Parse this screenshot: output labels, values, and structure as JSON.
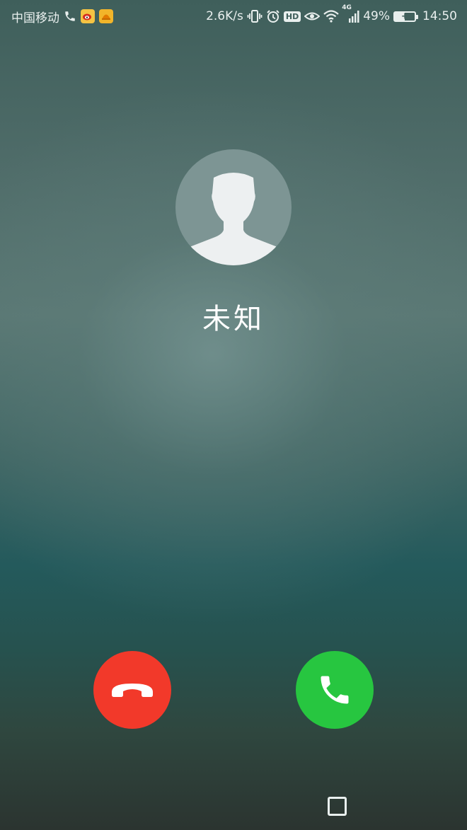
{
  "status_bar": {
    "carrier": "中国移动",
    "net_speed": "2.6K/s",
    "network_type": "4G",
    "battery_percent": "49%",
    "battery_level": 0.49,
    "time": "14:50",
    "hd_label": "HD",
    "icons": [
      "phone-icon",
      "weibo-app-icon",
      "app-notification-icon",
      "vibrate-icon",
      "alarm-icon",
      "hd-icon",
      "eye-comfort-icon",
      "wifi-icon",
      "signal-icon",
      "battery-charging-icon"
    ]
  },
  "caller": {
    "name": "未知",
    "avatar_icon": "default-avatar-icon"
  },
  "actions": {
    "decline_icon": "hang-up-icon",
    "answer_icon": "phone-answer-icon"
  },
  "navigation": {
    "recents_icon": "square-recents-icon"
  },
  "colors": {
    "decline": "#f2392a",
    "answer": "#27c640",
    "avatar_bg": "#7d9594"
  }
}
